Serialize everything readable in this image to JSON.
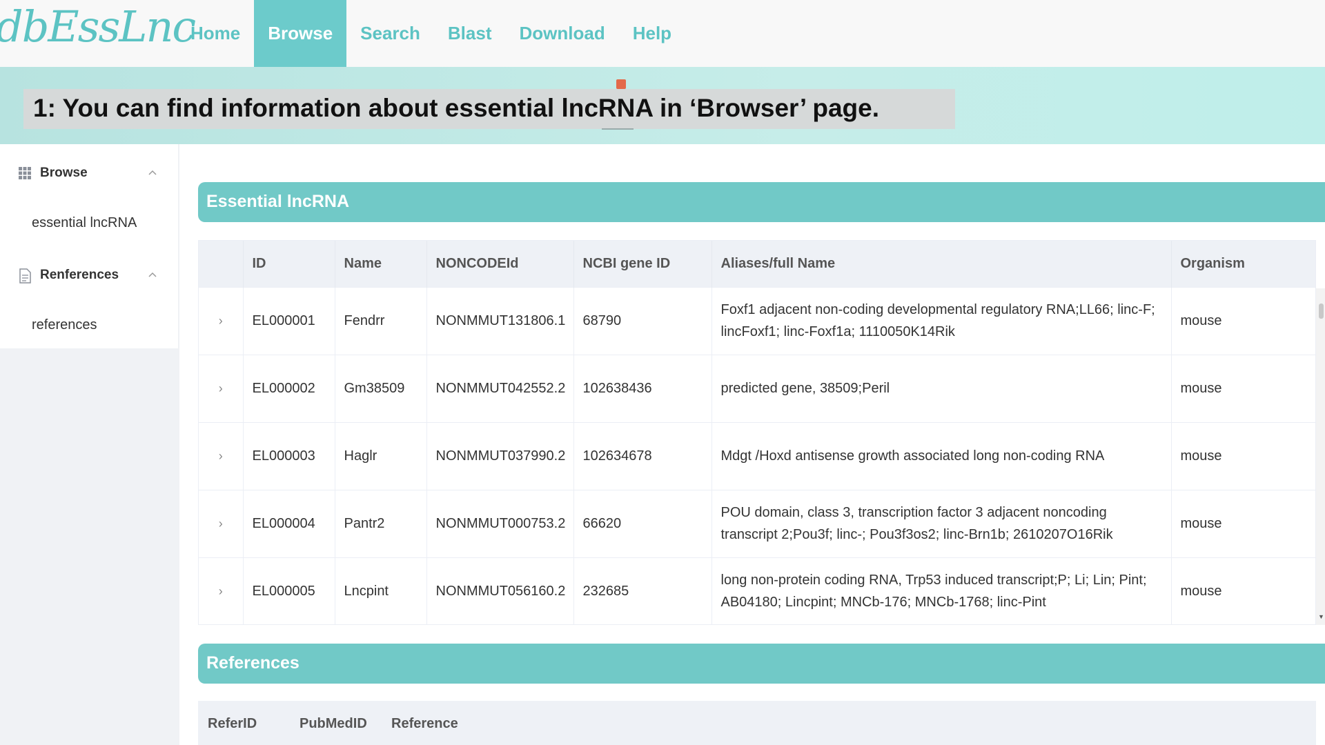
{
  "logo": "dbEssLnc",
  "nav": {
    "home": "Home",
    "browse": "Browse",
    "search": "Search",
    "blast": "Blast",
    "download": "Download",
    "help": "Help"
  },
  "banner": {
    "text": "1: You can find information about essential lncRNA in  ‘Browser’  page."
  },
  "sidebar": {
    "browse_label": "Browse",
    "browse_item": "essential lncRNA",
    "references_label": "Renferences",
    "references_item": "references"
  },
  "essential": {
    "title": "Essential lncRNA",
    "columns": [
      "ID",
      "Name",
      "NONCODEId",
      "NCBI gene ID",
      "Aliases/full Name",
      "Organism"
    ],
    "rows": [
      {
        "id": "EL000001",
        "name": "Fendrr",
        "noncode": "NONMMUT131806.1",
        "ncbi": "68790",
        "aliases": "Foxf1 adjacent non-coding developmental regulatory RNA;LL66; linc-F; lincFoxf1; linc-Foxf1a; 1110050K14Rik",
        "organism": "mouse"
      },
      {
        "id": "EL000002",
        "name": "Gm38509",
        "noncode": "NONMMUT042552.2",
        "ncbi": "102638436",
        "aliases": "predicted gene, 38509;Peril",
        "organism": "mouse"
      },
      {
        "id": "EL000003",
        "name": "Haglr",
        "noncode": "NONMMUT037990.2",
        "ncbi": "102634678",
        "aliases": "Mdgt /Hoxd antisense growth associated long non-coding RNA",
        "organism": "mouse"
      },
      {
        "id": "EL000004",
        "name": "Pantr2",
        "noncode": "NONMMUT000753.2",
        "ncbi": "66620",
        "aliases": "POU domain, class 3, transcription factor 3 adjacent noncoding transcript 2;Pou3f; linc-; Pou3f3os2; linc-Brn1b; 2610207O16Rik",
        "organism": "mouse"
      },
      {
        "id": "EL000005",
        "name": "Lncpint",
        "noncode": "NONMMUT056160.2",
        "ncbi": "232685",
        "aliases": "long non-protein coding RNA, Trp53 induced transcript;P; Li; Lin; Pint; AB04180; Lincpint; MNCb-176; MNCb-1768; linc-Pint",
        "organism": "mouse"
      }
    ]
  },
  "references": {
    "title": "References",
    "columns": [
      "ReferID",
      "PubMedID",
      "Reference"
    ]
  },
  "colors": {
    "accent": "#71c9c7",
    "nav_text": "#5cc3c3",
    "banner_bg": "#c2ebe7"
  }
}
